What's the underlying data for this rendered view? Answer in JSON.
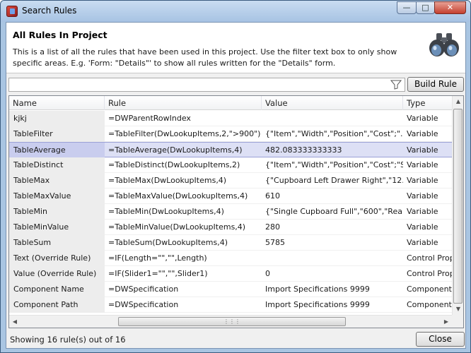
{
  "window": {
    "title": "Search Rules"
  },
  "header": {
    "title": "All Rules In Project",
    "description": "This is a list of all the rules that have been used in this project. Use the filter text box to only show specific areas. E.g. 'Form: \"Details\"' to show all rules written for the \"Details\" form."
  },
  "filter": {
    "value": "",
    "placeholder": ""
  },
  "buttons": {
    "build_rule": "Build Rule",
    "close": "Close"
  },
  "grid": {
    "columns": [
      "Name",
      "Rule",
      "Value",
      "Type"
    ],
    "selected_row": 2,
    "rows": [
      {
        "name": "kjkj",
        "rule": "=DWParentRowIndex",
        "value": "",
        "type": "Variable"
      },
      {
        "name": "TableFilter",
        "rule": "=TableFilter(DwLookupItems,2,\">900\")",
        "value": "{\"Item\",\"Width\",\"Position\",\"Cost\";\"...",
        "type": "Variable"
      },
      {
        "name": "TableAverage",
        "rule": "=TableAverage(DwLookupItems,4)",
        "value": "482.083333333333",
        "type": "Variable"
      },
      {
        "name": "TableDistinct",
        "rule": "=TableDistinct(DwLookupItems,2)",
        "value": "{\"Item\",\"Width\",\"Position\",\"Cost\";\"S...",
        "type": "Variable"
      },
      {
        "name": "TableMax",
        "rule": "=TableMax(DwLookupItems,4)",
        "value": "{\"Cupboard Left Drawer Right\",\"12...",
        "type": "Variable"
      },
      {
        "name": "TableMaxValue",
        "rule": "=TableMaxValue(DwLookupItems,4)",
        "value": "610",
        "type": "Variable"
      },
      {
        "name": "TableMin",
        "rule": "=TableMin(DwLookupItems,4)",
        "value": "{\"Single Cupboard Full\",\"600\",\"Rea...",
        "type": "Variable"
      },
      {
        "name": "TableMinValue",
        "rule": "=TableMinValue(DwLookupItems,4)",
        "value": "280",
        "type": "Variable"
      },
      {
        "name": "TableSum",
        "rule": "=TableSum(DwLookupItems,4)",
        "value": "5785",
        "type": "Variable"
      },
      {
        "name": "Text (Override Rule)",
        "rule": "=IF(Length=\"\",\"\",Length)",
        "value": "",
        "type": "Control Prop"
      },
      {
        "name": "Value (Override Rule)",
        "rule": "=IF(Slider1=\"\",\"\",Slider1)",
        "value": "0",
        "type": "Control Prop"
      },
      {
        "name": "Component Name",
        "rule": "=DWSpecification",
        "value": "Import Specifications 9999",
        "type": "Component"
      },
      {
        "name": "Component Path",
        "rule": "=DWSpecification",
        "value": "Import Specifications 9999",
        "type": "Component"
      }
    ]
  },
  "status": {
    "text": "Showing 16 rule(s) out of 16"
  },
  "icons": {
    "app": "app-icon",
    "binoculars": "binoculars-icon",
    "filter": "filter-funnel-icon"
  }
}
